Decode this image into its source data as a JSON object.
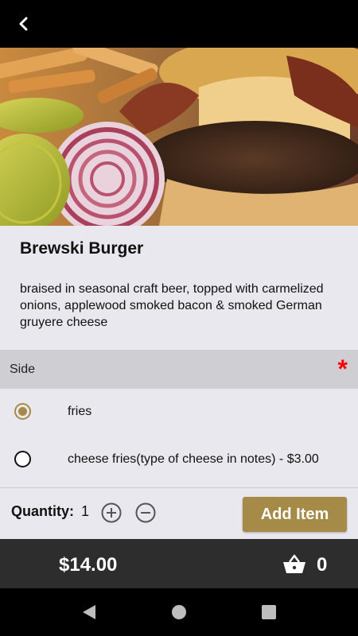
{
  "item": {
    "title": "Brewski Burger",
    "description": "braised in seasonal craft beer, topped with carmelized onions, applewood smoked bacon & smoked German gruyere cheese"
  },
  "side_section": {
    "label": "Side",
    "required_mark": "*",
    "options": [
      {
        "label": "fries",
        "selected": true
      },
      {
        "label": "cheese fries(type of cheese in notes) - $3.00",
        "selected": false
      }
    ]
  },
  "quantity": {
    "label": "Quantity:",
    "value": "1"
  },
  "add_item_label": "Add Item",
  "cart": {
    "total": "$14.00",
    "count": "0"
  },
  "colors": {
    "accent": "#a68a47",
    "required": "#ff0000",
    "cart_bar": "#2d2d2d"
  },
  "icons": [
    "back-chevron-icon",
    "plus-circle-icon",
    "minus-circle-icon",
    "basket-icon",
    "nav-back-icon",
    "nav-home-icon",
    "nav-recents-icon"
  ]
}
